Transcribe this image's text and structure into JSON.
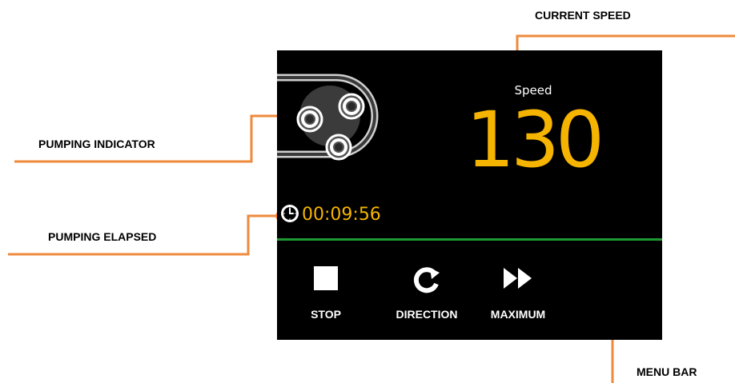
{
  "annotations": {
    "current_speed": "CURRENT SPEED",
    "pumping_indicator": "PUMPING INDICATOR",
    "pumping_elapsed": "PUMPING ELAPSED",
    "menu_bar": "MENU BAR"
  },
  "display": {
    "speed_label": "Speed",
    "speed_value": "130",
    "elapsed_time": "00:09:56"
  },
  "menu": {
    "stop": "STOP",
    "direction": "DIRECTION",
    "maximum": "MAXIMUM"
  },
  "colors": {
    "callout": "#ef8a3c",
    "accent": "#f5b400",
    "divider": "#1e9a32",
    "screen_bg": "#000000"
  },
  "icons": {
    "pump": "pump-rotor-icon",
    "clock": "clock-icon",
    "stop": "stop-icon",
    "direction": "direction-rotate-icon",
    "maximum": "fast-forward-icon"
  }
}
